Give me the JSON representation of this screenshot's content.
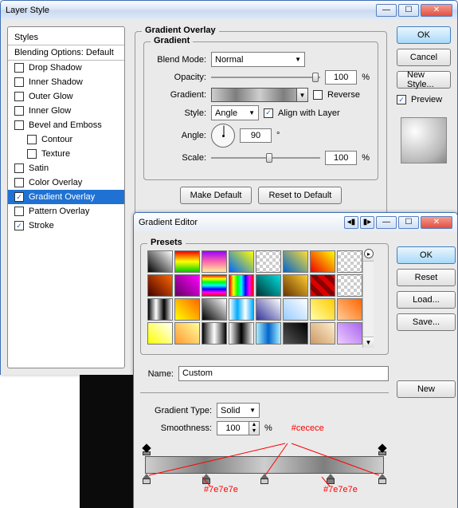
{
  "ls": {
    "title": "Layer Style",
    "styles_header": "Styles",
    "blending": "Blending Options: Default",
    "items": [
      {
        "label": "Drop Shadow",
        "checked": false,
        "indent": false,
        "selected": false
      },
      {
        "label": "Inner Shadow",
        "checked": false,
        "indent": false,
        "selected": false
      },
      {
        "label": "Outer Glow",
        "checked": false,
        "indent": false,
        "selected": false
      },
      {
        "label": "Inner Glow",
        "checked": false,
        "indent": false,
        "selected": false
      },
      {
        "label": "Bevel and Emboss",
        "checked": false,
        "indent": false,
        "selected": false
      },
      {
        "label": "Contour",
        "checked": false,
        "indent": true,
        "selected": false
      },
      {
        "label": "Texture",
        "checked": false,
        "indent": true,
        "selected": false
      },
      {
        "label": "Satin",
        "checked": false,
        "indent": false,
        "selected": false
      },
      {
        "label": "Color Overlay",
        "checked": false,
        "indent": false,
        "selected": false
      },
      {
        "label": "Gradient Overlay",
        "checked": true,
        "indent": false,
        "selected": true
      },
      {
        "label": "Pattern Overlay",
        "checked": false,
        "indent": false,
        "selected": false
      },
      {
        "label": "Stroke",
        "checked": true,
        "indent": false,
        "selected": false
      }
    ],
    "group_title": "Gradient Overlay",
    "subgroup_title": "Gradient",
    "blend_mode_lbl": "Blend Mode:",
    "blend_mode_val": "Normal",
    "opacity_lbl": "Opacity:",
    "opacity_val": "100",
    "pct": "%",
    "gradient_lbl": "Gradient:",
    "reverse_lbl": "Reverse",
    "style_lbl": "Style:",
    "style_val": "Angle",
    "align_lbl": "Align with Layer",
    "angle_lbl": "Angle:",
    "angle_val": "90",
    "deg": "°",
    "scale_lbl": "Scale:",
    "scale_val": "100",
    "make_default": "Make Default",
    "reset_default": "Reset to Default",
    "ok": "OK",
    "cancel": "Cancel",
    "new_style": "New Style...",
    "preview": "Preview"
  },
  "ge": {
    "title": "Gradient Editor",
    "presets": "Presets",
    "name_lbl": "Name:",
    "name_val": "Custom",
    "new_btn": "New",
    "type_lbl": "Gradient Type:",
    "type_val": "Solid",
    "smooth_lbl": "Smoothness:",
    "smooth_val": "100",
    "pct": "%",
    "ok": "OK",
    "reset": "Reset",
    "load": "Load...",
    "save": "Save...",
    "anno_top": "#cecece",
    "anno_b1": "#7e7e7e",
    "anno_b2": "#7e7e7e",
    "preset_bgs": [
      "linear-gradient(45deg,#000,#fff)",
      "linear-gradient(#e00,#ff0,#0c0)",
      "linear-gradient(#90f,#f6a,#fe9)",
      "linear-gradient(45deg,#06f,#ff0)",
      "repeating-conic-gradient(#ccc 0 25%,#fff 0 50%) 0/8px 8px",
      "linear-gradient(45deg,#06c,#fd3)",
      "linear-gradient(45deg,#e00,#ff0)",
      "repeating-conic-gradient(#ccc 0 25%,#fff 0 50%) 0/8px 8px",
      "linear-gradient(45deg,#400,#f60)",
      "linear-gradient(45deg,#606,#f0f)",
      "linear-gradient(#f00,#ff0,#0f0,#0ff,#00f,#f0f,#f00)",
      "linear-gradient(90deg,#f00,#ff0,#0f0,#0ff,#00f,#f0f,#f00)",
      "linear-gradient(45deg,#033,#0dd)",
      "linear-gradient(45deg,#630,#fc3)",
      "repeating-linear-gradient(45deg,#d00 0 6px,#800 6px 12px)",
      "repeating-conic-gradient(#ccc 0 25%,#fff 0 50%) 0/8px 8px",
      "linear-gradient(90deg,#000,#fff,#000,#fff)",
      "linear-gradient(45deg,#ff0,#f60)",
      "linear-gradient(45deg,#000,#fff)",
      "linear-gradient(90deg,#fff,#0af,#fff,#0af)",
      "linear-gradient(45deg,#339,#fff)",
      "linear-gradient(45deg,#9cf,#fff)",
      "linear-gradient(45deg,#ffa,#fc0)",
      "linear-gradient(45deg,#fc9,#f60)",
      "linear-gradient(45deg,#ff0,#fff)",
      "linear-gradient(45deg,#f93,#ff9)",
      "linear-gradient(90deg,#000,#888,#fff,#888,#000)",
      "linear-gradient(90deg,#fff,#000,#fff)",
      "linear-gradient(90deg,#aef,#06c,#aef)",
      "linear-gradient(45deg,#555,#000)",
      "linear-gradient(45deg,#c96,#fec)",
      "linear-gradient(45deg,#ecf,#a6e)"
    ]
  }
}
